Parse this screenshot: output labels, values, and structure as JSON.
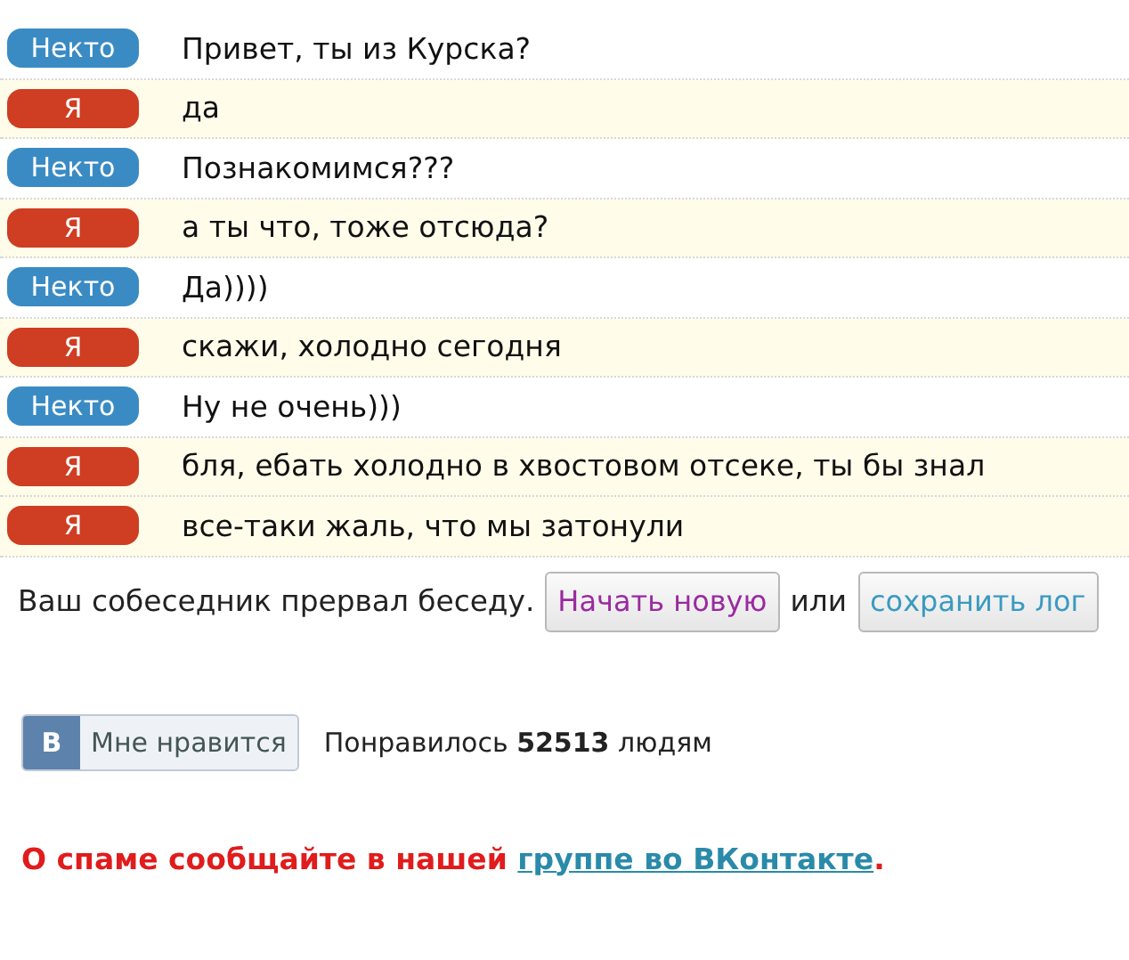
{
  "messages": [
    {
      "kind": "stranger",
      "label": "Некто",
      "text": "Привет, ты из Курска?"
    },
    {
      "kind": "me",
      "label": "Я",
      "text": "да"
    },
    {
      "kind": "stranger",
      "label": "Некто",
      "text": "Познакомимся???"
    },
    {
      "kind": "me",
      "label": "Я",
      "text": "а ты что, тоже отсюда?"
    },
    {
      "kind": "stranger",
      "label": "Некто",
      "text": "Да))))"
    },
    {
      "kind": "me",
      "label": "Я",
      "text": "скажи, холодно сегодня"
    },
    {
      "kind": "stranger",
      "label": "Некто",
      "text": "Ну не очень)))"
    },
    {
      "kind": "me",
      "label": "Я",
      "text": "бля, ебать холодно в хвостовом отсеке, ты бы знал"
    },
    {
      "kind": "me",
      "label": "Я",
      "text": "все-таки жаль, что мы затонули"
    }
  ],
  "status": {
    "text": "Ваш собеседник прервал беседу.",
    "new_chat_button": "Начать новую",
    "separator": "или",
    "save_log_button": "сохранить лог"
  },
  "like": {
    "logo": "В",
    "button": "Мне нравится",
    "count_text": "Понравилось **52513** людям"
  },
  "spam_notice": {
    "text": "О спаме сообщайте в нашей ",
    "link": "группе во ВКонтакте",
    "end": "."
  }
}
